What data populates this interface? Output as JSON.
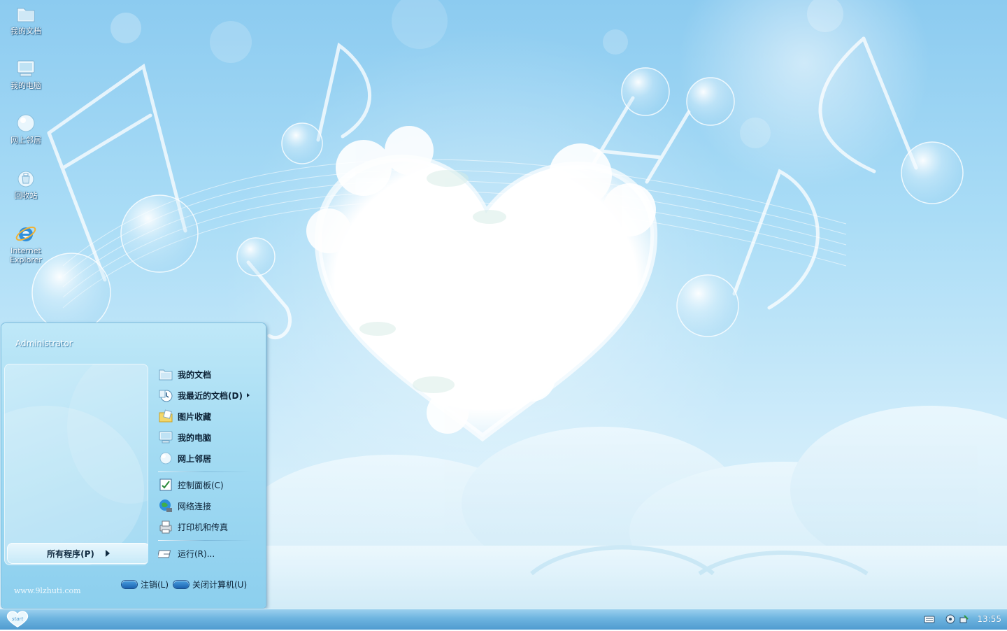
{
  "desktop": {
    "icons": [
      {
        "label": "我的文档",
        "icon": "my-documents-icon"
      },
      {
        "label": "我的电脑",
        "icon": "my-computer-icon"
      },
      {
        "label": "网上邻居",
        "icon": "network-places-icon"
      },
      {
        "label": "回收站",
        "icon": "recycle-bin-icon"
      },
      {
        "label_line1": "Internet",
        "label_line2": "Explorer",
        "icon": "internet-explorer-icon"
      }
    ]
  },
  "start_menu": {
    "username": "Administrator",
    "all_programs": "所有程序(P)",
    "items": [
      {
        "label": "我的文档",
        "icon": "my-documents-icon"
      },
      {
        "label": "我最近的文档(D)",
        "icon": "recent-documents-icon"
      },
      {
        "label": "图片收藏",
        "icon": "my-pictures-icon"
      },
      {
        "label": "我的电脑",
        "icon": "my-computer-icon"
      },
      {
        "label": "网上邻居",
        "icon": "network-places-icon"
      },
      {
        "label": "控制面板(C)",
        "icon": "control-panel-icon"
      },
      {
        "label": "网络连接",
        "icon": "network-connections-icon"
      },
      {
        "label": "打印机和传真",
        "icon": "printers-faxes-icon"
      },
      {
        "label": "运行(R)...",
        "icon": "run-icon"
      }
    ],
    "logoff": "注销(L)",
    "shutdown": "关闭计算机(U)",
    "watermark": "www.9lzhuti.com"
  },
  "taskbar": {
    "start_label": "start",
    "clock": "13:55"
  },
  "colors": {
    "sky_top": "#8ccbf0",
    "sky_bottom": "#e6f5fd",
    "menu_blue": "#a5dcf3",
    "taskbar_blue": "#6fb5e0"
  }
}
